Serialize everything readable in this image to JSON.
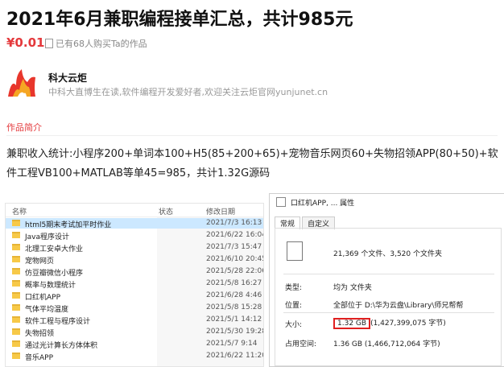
{
  "title": "2021年6月兼职编程接单汇总，共计985元",
  "price": "¥0.01",
  "bought": "已有68人购买Ta的作品",
  "author": {
    "name": "科大云炬",
    "desc": "中科大直博生在读,软件编程开发爱好者,欢迎关注云炬官网yunjunet.cn"
  },
  "section_label": "作品简介",
  "description": "兼职收入统计:小程序200+单词本100+H5(85+200+65)+宠物音乐网页60+失物招领APP(80+50)+软件工程VB100+MATLAB等单45=985，共计1.32G源码",
  "explorer": {
    "headers": [
      "名称",
      "状态",
      "修改日期"
    ],
    "rows": [
      {
        "name": "html5期末考试加平时作业",
        "date": "2021/7/3 16:13"
      },
      {
        "name": "Java程序设计",
        "date": "2021/6/22 16:04"
      },
      {
        "name": "北理工安卓大作业",
        "date": "2021/7/3 15:47"
      },
      {
        "name": "宠物网页",
        "date": "2021/6/10 20:45"
      },
      {
        "name": "仿豆瓣微信小程序",
        "date": "2021/5/28 22:06"
      },
      {
        "name": "概率与数理统计",
        "date": "2021/5/8 16:27"
      },
      {
        "name": "口红机APP",
        "date": "2021/6/28 4:46"
      },
      {
        "name": "气体平均温度",
        "date": "2021/5/8 15:28"
      },
      {
        "name": "软件工程与程序设计",
        "date": "2021/5/1 14:12"
      },
      {
        "name": "失物招领",
        "date": "2021/5/30 19:28"
      },
      {
        "name": "通过光计算长方体体积",
        "date": "2021/5/7 9:14"
      },
      {
        "name": "音乐APP",
        "date": "2021/6/22 11:20"
      }
    ]
  },
  "dialog": {
    "title": "口红机APP, ... 属性",
    "tabs": [
      "常规",
      "自定义"
    ],
    "counts": "21,369 个文件、3,520 个文件夹",
    "type_label": "类型:",
    "type_value": "均为 文件夹",
    "location_label": "位置:",
    "location_value": "全部位于 D:\\华为云盘\\Library\\师兄帮帮",
    "size_label": "大小:",
    "size_value": "1.32 GB",
    "size_bytes": "(1,427,399,075 字节)",
    "disk_label": "占用空间:",
    "disk_value": "1.36 GB (1,466,712,064 字节)"
  }
}
